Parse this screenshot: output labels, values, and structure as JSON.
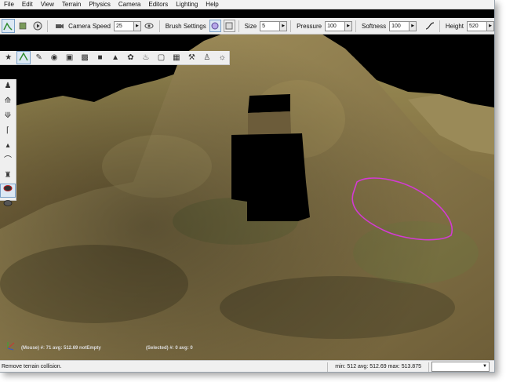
{
  "menu": [
    "File",
    "Edit",
    "View",
    "Terrain",
    "Physics",
    "Camera",
    "Editors",
    "Lighting",
    "Help"
  ],
  "toolbar": {
    "camera_speed_label": "Camera Speed",
    "camera_speed_value": "25",
    "brush_settings_label": "Brush Settings",
    "size_label": "Size",
    "size_value": "5",
    "pressure_label": "Pressure",
    "pressure_value": "100",
    "softness_label": "Softness",
    "softness_value": "100",
    "height_label": "Height",
    "height_value": "520"
  },
  "viewport": {
    "mouse_info": "(Mouse) #: 71  avg: 512.69 notEmpty",
    "selected_info": "(Selected) #: 0  avg: 0"
  },
  "status": {
    "message": "Remove terrain collision.",
    "stats": "min: 512  avg: 512.69  max: 513.875",
    "dropdown_value": ""
  },
  "colors": {
    "sky": "#000000",
    "terrain_base": "#8a7a4a",
    "brush_outline": "#d43ad4"
  }
}
